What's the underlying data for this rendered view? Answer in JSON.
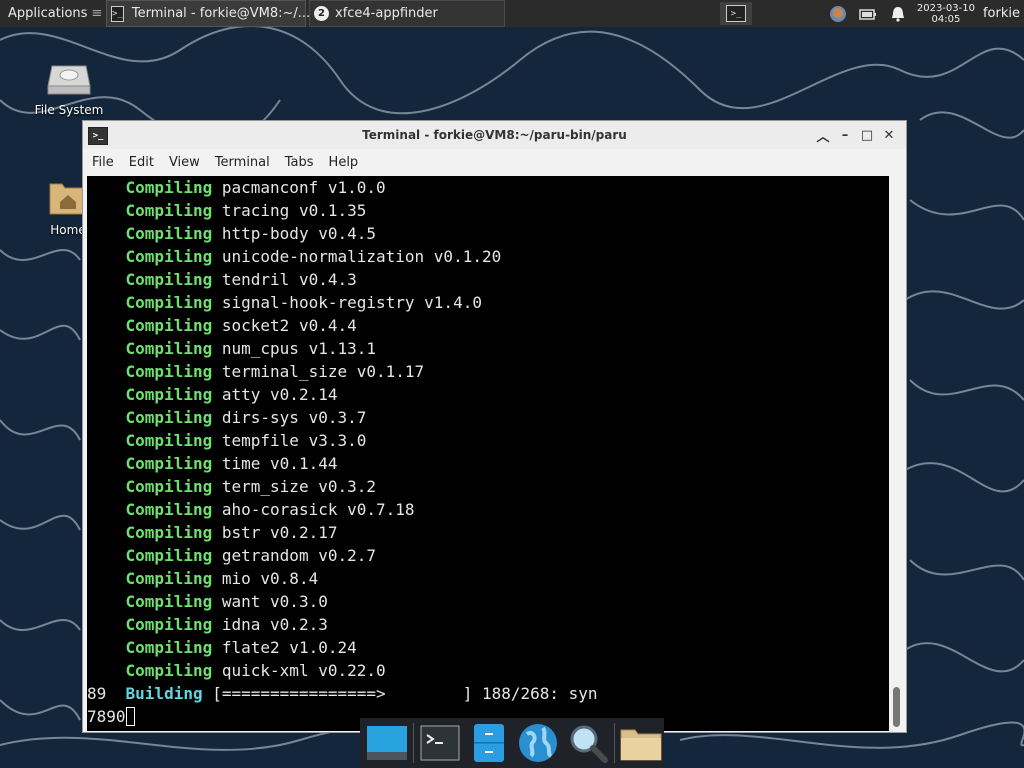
{
  "top_panel": {
    "apps_menu_label": "Applications",
    "tasks": [
      {
        "label": "Terminal - forkie@VM8:~/...",
        "icon": "terminal-icon"
      },
      {
        "label": "xfce4-appfinder",
        "badge": "2",
        "icon": "appfinder-icon"
      }
    ],
    "clock": {
      "date": "2023-03-10",
      "time": "04:05"
    },
    "user": "forkie"
  },
  "desktop_icons": [
    {
      "label": "File System",
      "icon": "drive-icon"
    },
    {
      "label": "Home",
      "icon": "home-folder-icon"
    }
  ],
  "window": {
    "title": "Terminal - forkie@VM8:~/paru-bin/paru",
    "menu": [
      "File",
      "Edit",
      "View",
      "Terminal",
      "Tabs",
      "Help"
    ]
  },
  "terminal": {
    "keyword": "Compiling",
    "compiling": [
      "pacmanconf v1.0.0",
      "tracing v0.1.35",
      "http-body v0.4.5",
      "unicode-normalization v0.1.20",
      "tendril v0.4.3",
      "signal-hook-registry v1.4.0",
      "socket2 v0.4.4",
      "num_cpus v1.13.1",
      "terminal_size v0.1.17",
      "atty v0.2.14",
      "dirs-sys v0.3.7",
      "tempfile v3.3.0",
      "time v0.1.44",
      "term_size v0.3.2",
      "aho-corasick v0.7.18",
      "bstr v0.2.17",
      "getrandom v0.2.7",
      "mio v0.8.4",
      "want v0.3.0",
      "idna v0.2.3",
      "flate2 v1.0.24",
      "quick-xml v0.22.0"
    ],
    "status_prefix": "89",
    "status_keyword": "Building",
    "progress_bar": "[================>        ]",
    "progress_text": "188/268: syn",
    "last_line": "7890"
  },
  "colors": {
    "keyword": "#6ee06e",
    "building": "#5fd7e0",
    "terminal_bg": "#000000",
    "panel_bg": "#2b2b2b"
  }
}
